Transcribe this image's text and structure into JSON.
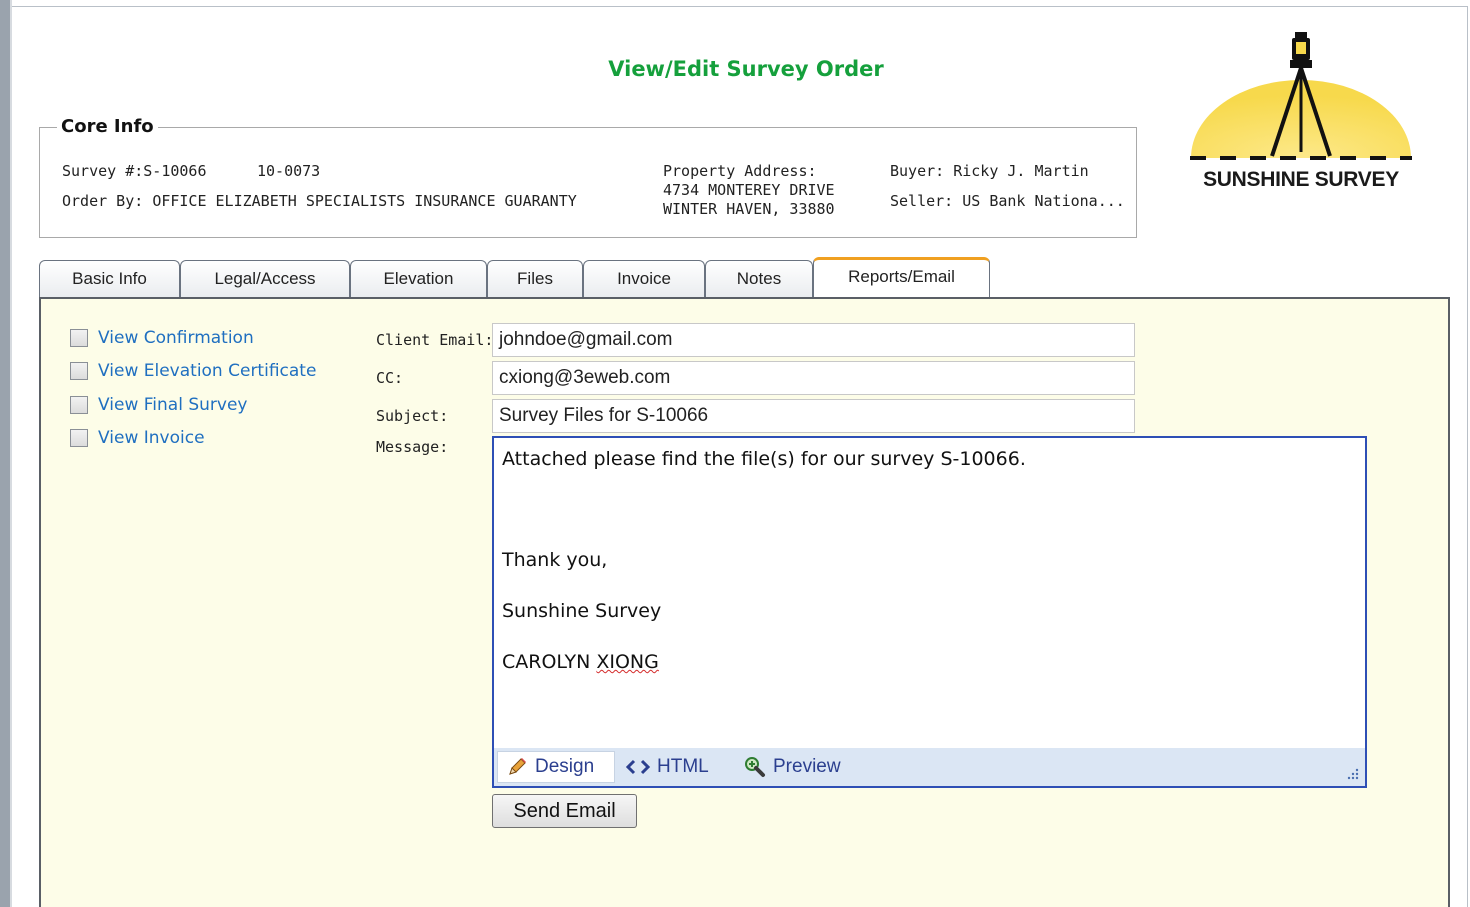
{
  "page": {
    "title": "View/Edit Survey Order"
  },
  "logo": {
    "text": "SUNSHINE SURVEY",
    "colors": {
      "sun": "#f7d94c",
      "sun_highlight": "#fde98a",
      "tripod": "#111111"
    }
  },
  "core_info": {
    "legend": "Core Info",
    "survey_label": "Survey #:",
    "survey_number": "S-10066",
    "survey_code": "10-0073",
    "order_by_label": "Order By:",
    "order_by": "OFFICE ELIZABETH SPECIALISTS INSURANCE GUARANTY",
    "property_address_label": "Property Address:",
    "property_address_line1": "4734 MONTEREY DRIVE",
    "property_address_line2": "WINTER HAVEN, 33880",
    "buyer_label": "Buyer:",
    "buyer": "Ricky J. Martin",
    "seller_label": "Seller:",
    "seller": "US Bank Nationa..."
  },
  "tabs": [
    {
      "label": "Basic Info",
      "active": false
    },
    {
      "label": "Legal/Access",
      "active": false
    },
    {
      "label": "Elevation",
      "active": false
    },
    {
      "label": "Files",
      "active": false
    },
    {
      "label": "Invoice",
      "active": false
    },
    {
      "label": "Notes",
      "active": false
    },
    {
      "label": "Reports/Email",
      "active": true
    }
  ],
  "reports": [
    {
      "label": "View Confirmation",
      "checked": false
    },
    {
      "label": "View Elevation Certificate",
      "checked": false
    },
    {
      "label": "View Final Survey",
      "checked": false
    },
    {
      "label": "View Invoice",
      "checked": false
    }
  ],
  "email_form": {
    "client_email_label": "Client Email:",
    "client_email": "johndoe@gmail.com",
    "cc_label": "CC:",
    "cc": "cxiong@3eweb.com",
    "subject_label": "Subject:",
    "subject": "Survey Files for S-10066",
    "message_label": "Message:",
    "message": {
      "line1": "Attached please find the file(s) for our survey S-10066.",
      "line2": "Thank you,",
      "line3": "Sunshine Survey",
      "line4_first": "CAROLYN",
      "line4_last": "XIONG"
    }
  },
  "editor_modes": [
    {
      "label": "Design",
      "icon": "pencil-icon",
      "active": true
    },
    {
      "label": "HTML",
      "icon": "code-brackets-icon",
      "active": false
    },
    {
      "label": "Preview",
      "icon": "magnifier-icon",
      "active": false
    }
  ],
  "send_button": {
    "label": "Send Email"
  },
  "colors": {
    "title_green": "#15a03c",
    "link_blue": "#1f6fc0",
    "panel_bg": "#fdfde8",
    "active_tab_accent": "#f0a020",
    "editor_border": "#2e4fb5"
  }
}
